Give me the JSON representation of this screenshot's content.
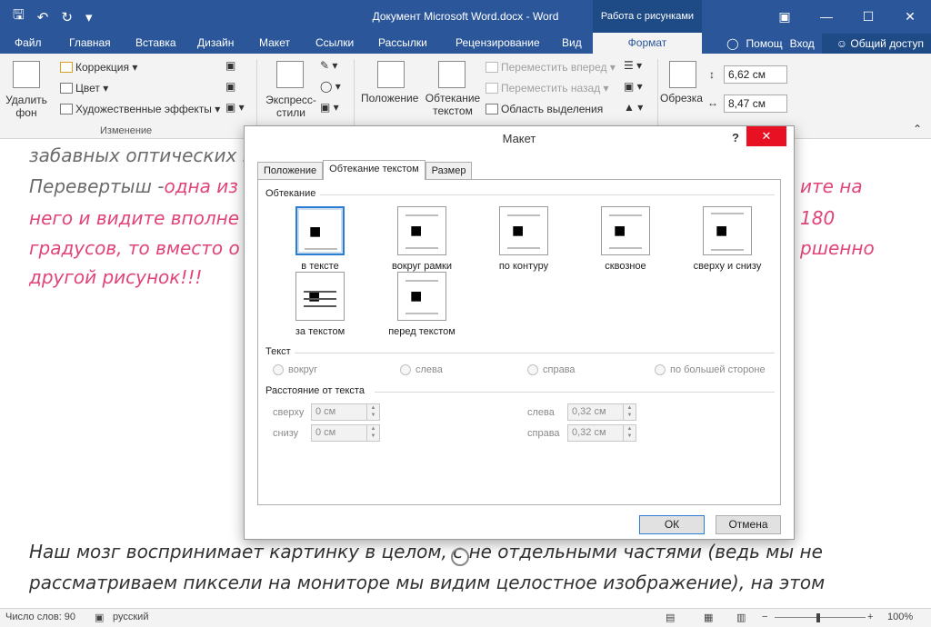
{
  "app": {
    "doc_title": "Документ Microsoft Word.docx - Word",
    "context_tab_label": "Работа с рисунками"
  },
  "qat": {
    "save_icon": "save-icon",
    "undo_icon": "undo-icon",
    "redo_icon": "redo-icon"
  },
  "tabs": [
    "Файл",
    "Главная",
    "Вставка",
    "Дизайн",
    "Макет",
    "Ссылки",
    "Рассылки",
    "Рецензирование",
    "Вид",
    "Формат"
  ],
  "active_tab": "Формат",
  "helpers": {
    "tellme": "Помощ",
    "signin": "Вход",
    "share": "Общий доступ"
  },
  "ribbon": {
    "remove_bg": "Удалить фон",
    "correction": "Коррекция",
    "color": "Цвет",
    "art_effects": "Художественные эффекты",
    "group_change": "Изменение",
    "express_styles": "Экспресс-стили",
    "position": "Положение",
    "wrap_text": "Обтекание текстом",
    "bring_forward": "Переместить вперед",
    "send_backward": "Переместить назад",
    "selection_pane": "Область выделения",
    "crop": "Обрезка",
    "height": "6,62 см",
    "width": "8,47 см"
  },
  "document": {
    "line1": "забавных оптических и",
    "line2_gray": "Перевертыш -",
    "line2_pink": "одна из о",
    "line2_right": "ите на",
    "line3": "него и видите вполне о",
    "line3_right": "180",
    "line4": "градусов, то вместо о",
    "line4_right": "ршенно",
    "line5": "другой рисунок!!!",
    "line6": "Наш мозг воспринимает картинку в целом, с не отдельными частями (ведь мы не",
    "line7": "рассматриваем пиксели на мониторе мы видим целостное изображение), на этом"
  },
  "dialog": {
    "title": "Макет",
    "help": "?",
    "close": "✕",
    "tabs": [
      "Положение",
      "Обтекание текстом",
      "Размер"
    ],
    "section_wrap": "Обтекание",
    "wrap_options": [
      {
        "label": "в тексте",
        "selected": true
      },
      {
        "label": "вокруг рамки",
        "selected": false
      },
      {
        "label": "по контуру",
        "selected": false
      },
      {
        "label": "сквозное",
        "selected": false
      },
      {
        "label": "сверху и снизу",
        "selected": false
      },
      {
        "label": "за текстом",
        "selected": false
      },
      {
        "label": "перед текстом",
        "selected": false
      }
    ],
    "section_text": "Текст",
    "text_options": [
      "вокруг",
      "слева",
      "справа",
      "по большей стороне"
    ],
    "section_distance": "Расстояние от текста",
    "distance": {
      "top_label": "сверху",
      "top_value": "0 см",
      "bottom_label": "снизу",
      "bottom_value": "0 см",
      "left_label": "слева",
      "left_value": "0,32 см",
      "right_label": "справа",
      "right_value": "0,32 см"
    },
    "ok": "ОК",
    "cancel": "Отмена"
  },
  "statusbar": {
    "words": "Число слов: 90",
    "language": "русский",
    "zoom": "100%"
  }
}
